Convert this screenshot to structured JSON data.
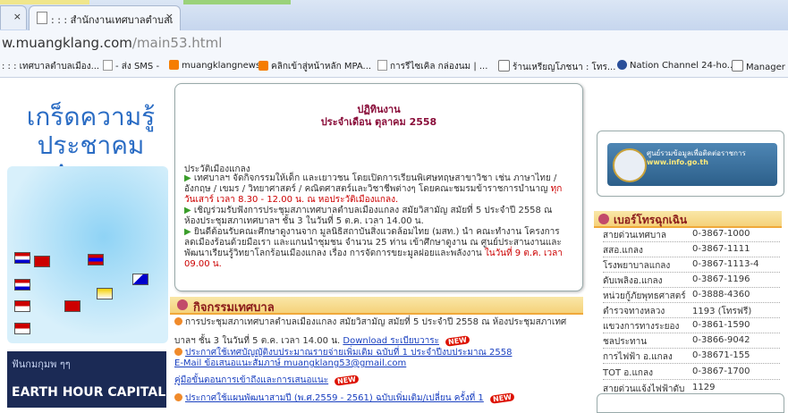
{
  "browser": {
    "tab_title": ": : : สำนักงานเทศบาลตำบลเ",
    "tab_close": "×",
    "url_host": "w.muangklang.com",
    "url_path": "/main53.html"
  },
  "bookmarks": [
    {
      "label": ": : : เทศบาลตำบลเมือง...",
      "icon": "page-icon"
    },
    {
      "label": "- ส่ง SMS -",
      "icon": "page-icon"
    },
    {
      "label": "muangklangnews",
      "icon": "blogger-icon"
    },
    {
      "label": "คลิกเข้าสู่หน้าหลัก MPA...",
      "icon": "blogger-icon"
    },
    {
      "label": "การรีไซเคิล กล่องนม | ...",
      "icon": "page-icon"
    },
    {
      "label": "ร้านเหรียญโภชนา : โทร...",
      "icon": "logo-icon"
    },
    {
      "label": "Nation Channel 24-ho...",
      "icon": "globe-icon"
    },
    {
      "label": "Manager O",
      "icon": "manager-icon"
    }
  ],
  "left": {
    "asean_title_1": "เกร็ดความรู้",
    "asean_title_2": "ประชาคม Asean",
    "earth_line1": "ฟันกมกุมพ ๆๆ",
    "earth_line2": "EARTH HOUR CAPITAL 2014"
  },
  "notice": {
    "title1": "ปฏิทินงาน",
    "title2": "ประจำเดือน ตุลาคม 2558",
    "section": "ประวัติเมืองแกลง",
    "items": [
      {
        "text": "เทศบาลฯ จัดกิจกรรมให้เด็ก และเยาวชน โดยเปิดการเรียนพิเศษทฤษสาขาวิชา เช่น ภาษาไทย / อังกฤษ / เขมร / วิทยาศาสตร์ / คณิตศาสตร์และวิชาชีพต่างๆ โดยคณะชมรมข้าราชการบำนาญ",
        "highlight": "ทุกวันเสาร์ เวลา 8.30 - 12.00 น. ณ หอประวัติเมืองแกลง."
      },
      {
        "text": "เชิญร่วมรับฟังการประชุมสภาเทศบาลตำบลเมืองแกลง สมัยวิสามัญ สมัยที่ 5 ประจำปี 2558 ณ ห้องประชุมสภาเทศบาลฯ ชั้น 3 ในวันที่ 5 ต.ค. เวลา 14.00 น.",
        "highlight": ""
      },
      {
        "text": "ยินดีต้อนรับคณะศึกษาดูงานจาก มูลนิธิสถาบันสิ่งแวดล้อมไทย (มสท.) นำ คณะทำงาน โครงการลดเมืองร้อนด้วยมือเรา และแกนนำชุมชน จำนวน 25 ท่าน เข้าศึกษาดูงาน ณ ศูนย์ประสานงานและพัฒนาเรียนรู้วิทยาโลกร้อนเมืองแกลง เรื่อง การจัดการขยะมูลฝอยและพลังงาน",
        "highlight": "ในวันที่ 9 ต.ค. เวลา 09.00 น."
      }
    ]
  },
  "activities": {
    "header": "กิจกรรมเทศบาล",
    "items": [
      {
        "text": "การประชุมสภาเทศบาลตำบลเมืองแกลง สมัยวิสามัญ สมัยที่ 5 ประจำปี 2558 ณ ห้องประชุมสภาเทศ"
      },
      {
        "text": "บาลฯ ชั้น 3 ในวันที่ 5 ต.ค. เวลา 14.00 น.",
        "link": "Download ระเบียบวาระ"
      },
      {
        "link": "ประกาศใช้เทศบัญญัติงบประมาณรายจ่ายเพิ่มเติม ฉบับที่ 1 ประจำปีงบประมาณ 2558"
      },
      {
        "link": "E-Mail ข้อเสนอแนะสัมภาษ์ muangklang53@gmail.com"
      },
      {
        "link": "คู่มือขั้นตอนการเข้าถึงและการเสนอแนะ"
      },
      {
        "link": "ประกาศใช้แผนพัฒนาสามปี (พ.ศ.2559 - 2561) ฉบับเพิ่มเติม/เปลี่ยน ครั้งที่ 1"
      }
    ],
    "new_badge": "NEW"
  },
  "right": {
    "info_line1": "ศูนย์รวมข้อมูลเพื่อติดต่อราชการ",
    "info_line2": "www.info.go.th",
    "phone_header": "เบอร์โทรฉุกเฉิน",
    "phones": [
      {
        "name": "สายด่วนเทศบาล",
        "number": "0-3867-1000"
      },
      {
        "name": "สสอ.แกลง",
        "number": "0-3867-1111"
      },
      {
        "name": "โรงพยาบาลแกลง",
        "number": "0-3867-1113-4"
      },
      {
        "name": "ดับเพลิงอ.แกลง",
        "number": "0-3867-1196"
      },
      {
        "name": "หน่วยกู้ภัยพุทธศาสตร์",
        "number": "0-3888-4360"
      },
      {
        "name": "ตำรวจทางหลวง",
        "number": "1193 (โทรฟรี)"
      },
      {
        "name": "แขวงการทางระยอง",
        "number": "0-3861-1590"
      },
      {
        "name": "ชลประทาน",
        "number": "0-3866-9042"
      },
      {
        "name": "การไฟฟ้า อ.แกลง",
        "number": "0-38671-155"
      },
      {
        "name": "TOT อ.แกลง",
        "number": "0-3867-1700"
      },
      {
        "name": "สายด่วนแจ้งไฟฟ้าดับ",
        "number": "1129"
      }
    ]
  }
}
